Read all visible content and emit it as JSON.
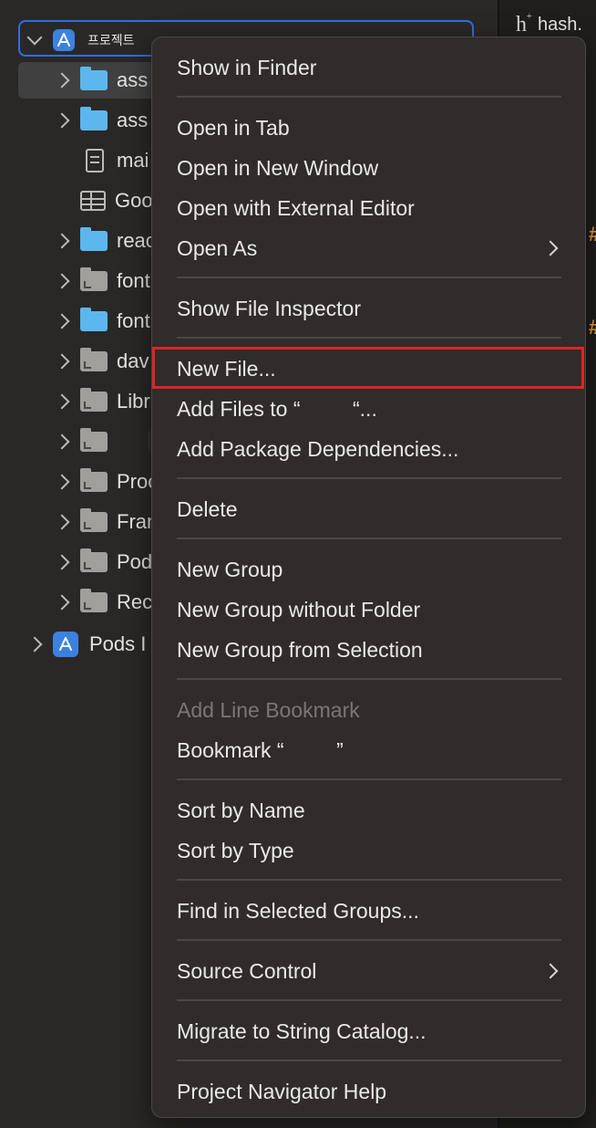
{
  "editor": {
    "tab_label": "hash.",
    "tab_icon": "h-plus-icon",
    "hash_mark": "#"
  },
  "navigator": {
    "root": {
      "label": "프로젝트",
      "icon": "app-store-icon"
    },
    "items": [
      {
        "label": "ass",
        "icon": "folder-blue",
        "expandable": true,
        "selected": true
      },
      {
        "label": "ass",
        "icon": "folder-blue",
        "expandable": true
      },
      {
        "label": "mai",
        "icon": "document-icon",
        "expandable": false
      },
      {
        "label": "Goo",
        "icon": "table-icon",
        "expandable": false
      },
      {
        "label": "reac",
        "icon": "folder-blue",
        "expandable": true
      },
      {
        "label": "font",
        "icon": "folder-grey",
        "expandable": true
      },
      {
        "label": "font",
        "icon": "folder-blue",
        "expandable": true
      },
      {
        "label": "dav",
        "icon": "folder-grey",
        "expandable": true
      },
      {
        "label": "Libr",
        "icon": "folder-grey",
        "expandable": true
      },
      {
        "label": "",
        "icon": "folder-grey",
        "expandable": true,
        "redacted": true
      },
      {
        "label": "Proc",
        "icon": "folder-grey",
        "expandable": true
      },
      {
        "label": "Fram",
        "icon": "folder-grey",
        "expandable": true
      },
      {
        "label": "Pod",
        "icon": "folder-grey",
        "expandable": true
      },
      {
        "label": "Rec",
        "icon": "folder-grey",
        "expandable": true
      }
    ],
    "pods": {
      "label": "Pods I",
      "icon": "app-store-icon"
    }
  },
  "context_menu": {
    "items": {
      "show_in_finder": "Show in Finder",
      "open_in_tab": "Open in Tab",
      "open_in_new_window": "Open in New Window",
      "open_with_external_editor": "Open with External Editor",
      "open_as": "Open As",
      "show_file_inspector": "Show File Inspector",
      "new_file": "New File...",
      "add_files_to": "Add Files to “         “...",
      "add_package_dependencies": "Add Package Dependencies...",
      "delete": "Delete",
      "new_group": "New Group",
      "new_group_without_folder": "New Group without Folder",
      "new_group_from_selection": "New Group from Selection",
      "add_line_bookmark": "Add Line Bookmark",
      "bookmark": "Bookmark “         ”",
      "sort_by_name": "Sort by Name",
      "sort_by_type": "Sort by Type",
      "find_in_selected_groups": "Find in Selected Groups...",
      "source_control": "Source Control",
      "migrate_to_string_catalog": "Migrate to String Catalog...",
      "project_navigator_help": "Project Navigator Help"
    },
    "highlighted_item": "new_file",
    "highlight_color": "#e02424"
  }
}
